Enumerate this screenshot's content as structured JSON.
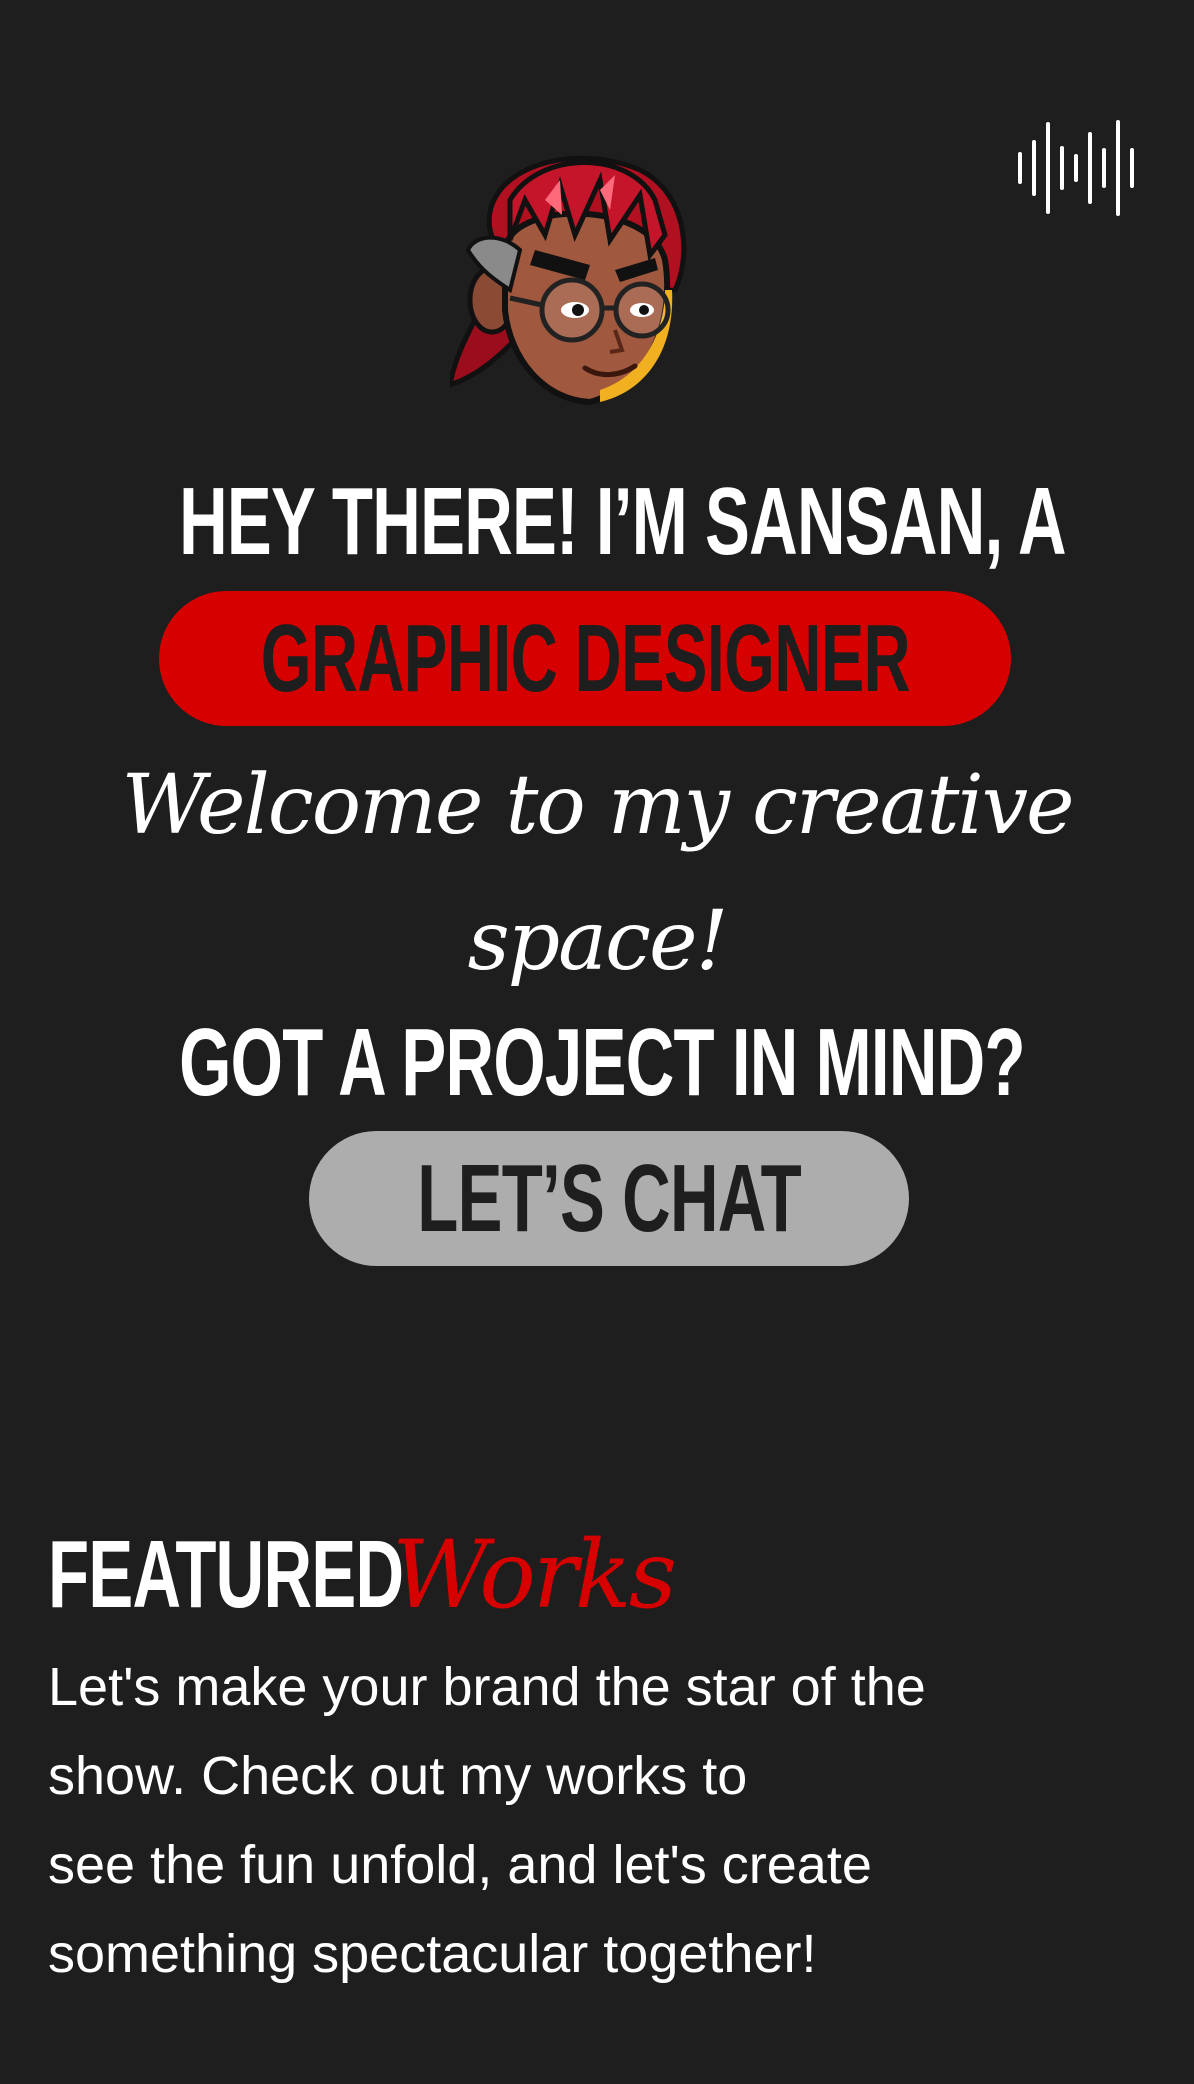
{
  "header": {
    "audio_icon": "soundwave-icon"
  },
  "hero": {
    "avatar_icon": "cartoon-avatar",
    "intro_line": "HEY THERE! I’M SANSAN, A",
    "role": "GRAPHIC DESIGNER",
    "welcome": "Welcome to my creative space!",
    "project_prompt": "GOT A PROJECT IN MIND?",
    "cta_label": "LET’S CHAT"
  },
  "featured": {
    "heading_bold": "FEATURED",
    "heading_italic": "Works",
    "description_lines": [
      "Let's make your brand the star of the",
      "show. Check out my works to",
      "see the fun unfold, and let's create",
      "something spectacular together!"
    ]
  },
  "colors": {
    "background": "#1e1e1e",
    "accent": "#d70000",
    "button": "#adadad",
    "text": "#ffffff"
  }
}
